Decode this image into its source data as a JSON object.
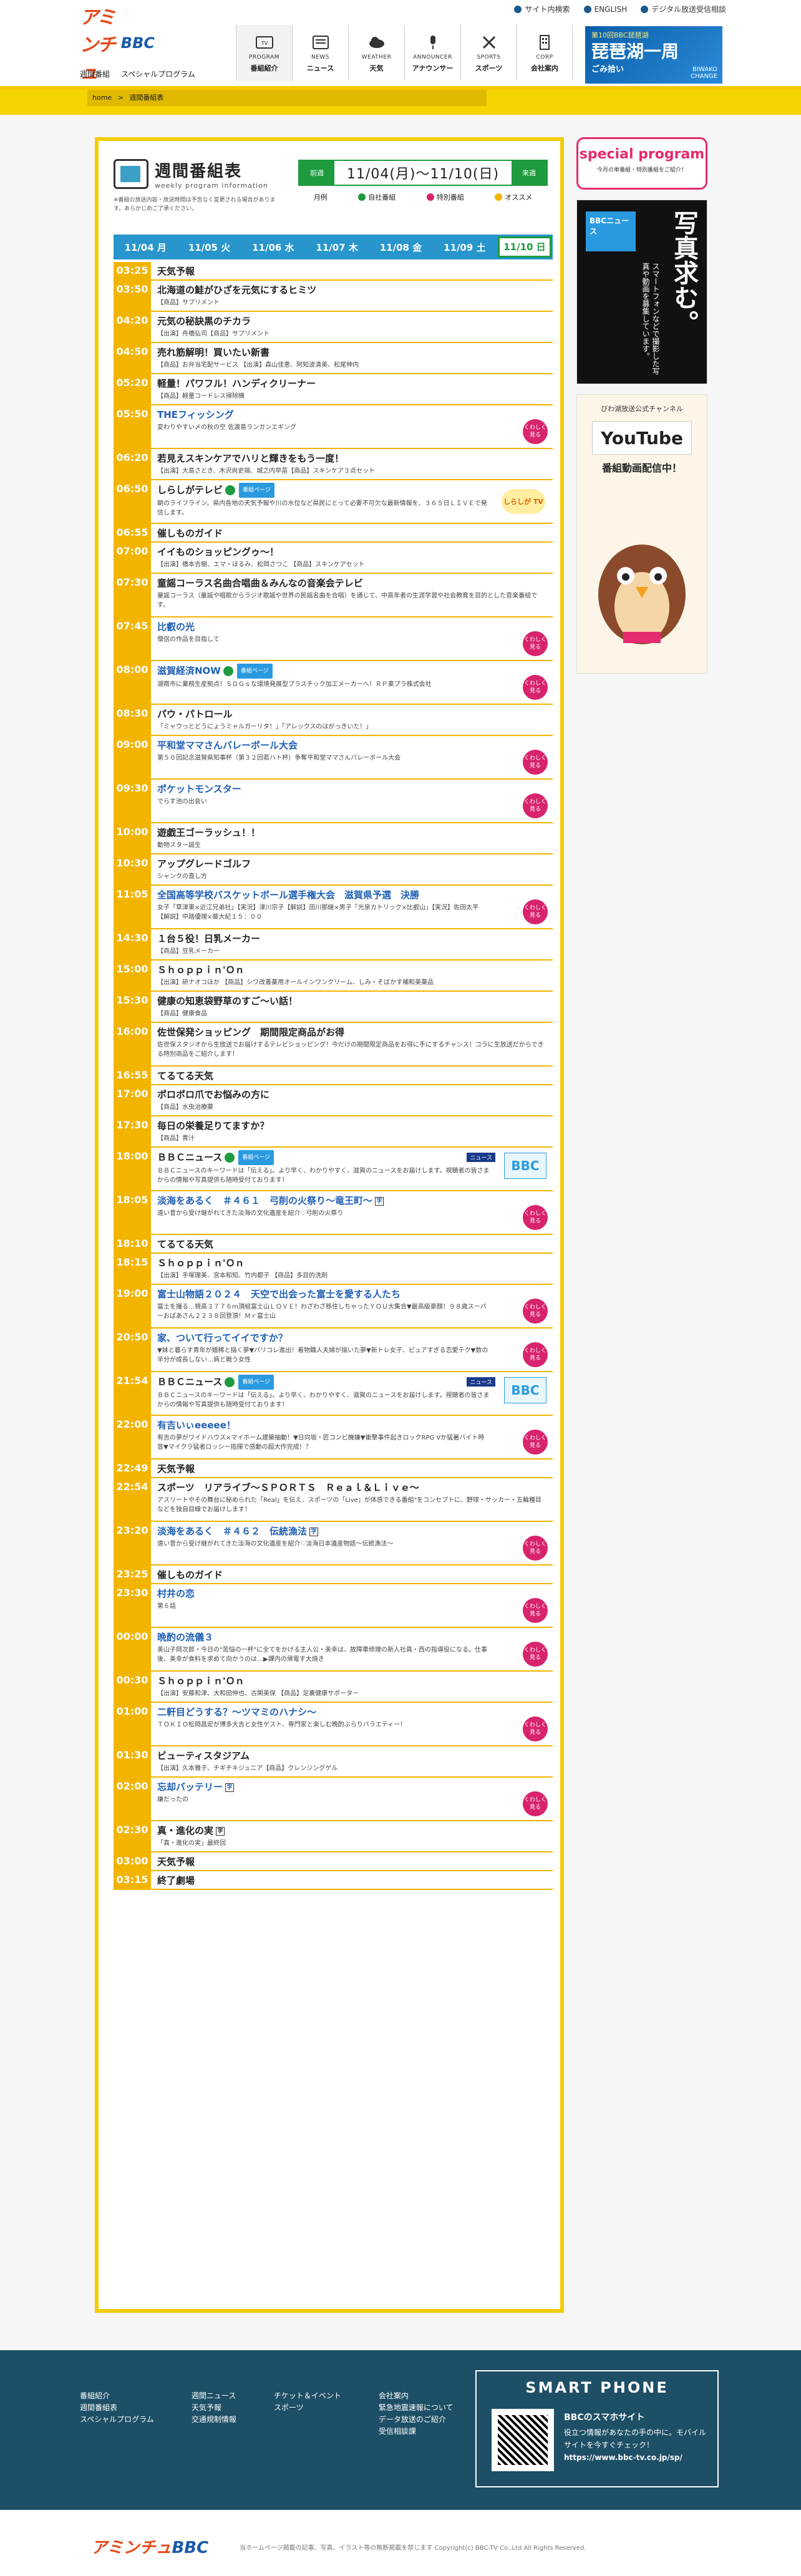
{
  "header": {
    "topbar": [
      "サイト内検索",
      "ENGLISH",
      "デジタル放送受信相談"
    ],
    "logo_a": "アミンチュ",
    "logo_b": "BBC",
    "sublinks": [
      "週間番組",
      "スペシャルプログラム"
    ],
    "nav": [
      {
        "en": "PROGRAM",
        "jp": "番組紹介",
        "icon": "tv-icon"
      },
      {
        "en": "NEWS",
        "jp": "ニュース",
        "icon": "news-icon"
      },
      {
        "en": "WEATHER",
        "jp": "天気",
        "icon": "weather-icon"
      },
      {
        "en": "ANNOUNCER",
        "jp": "アナウンサー",
        "icon": "mic-icon"
      },
      {
        "en": "SPORTS",
        "jp": "スポーツ",
        "icon": "sports-icon"
      },
      {
        "en": "CORP",
        "jp": "会社案内",
        "icon": "building-icon"
      }
    ],
    "banner_top": "第10回BBC琵琶湖",
    "banner_main": "琵琶湖一周",
    "banner_sub": "ごみ拾い",
    "banner_tag": "BIWAKO CHANGE"
  },
  "crumb": {
    "home": "home",
    "sep": ">",
    "current": "週間番組表"
  },
  "schedule": {
    "title": "週間番組表",
    "subtitle": "weekly program information",
    "note": "※番組の放送内容・放送時間は予告なく変更される場合があります。あらかじめご了承ください。",
    "prev": "前週",
    "next": "来週",
    "range": "11/04(月)～11/10(日)",
    "legend": [
      {
        "label": "月例",
        "color": "#ffffff"
      },
      {
        "label": "自社番組",
        "color": "#1d9b3e"
      },
      {
        "label": "特別番組",
        "color": "#d8236d"
      },
      {
        "label": "オススメ",
        "color": "#f3b400"
      }
    ],
    "days": [
      "11/04 月",
      "11/05 火",
      "11/06 水",
      "11/07 木",
      "11/08 金",
      "11/09 土",
      "11/10 日"
    ],
    "selected_day": 6
  },
  "programs": [
    {
      "t": "03:25",
      "title": "天気予報",
      "desc": "",
      "h": 30
    },
    {
      "t": "03:50",
      "title": "北海道の鮭がひざを元気にするヒミツ",
      "desc": "【商品】サプリメント",
      "h": 50
    },
    {
      "t": "04:20",
      "title": "元気の秘訣黒のチカラ",
      "desc": "【出演】舟橋弘司【商品】サプリメント",
      "h": 50
    },
    {
      "t": "04:50",
      "title": "売れ筋解明！買いたい新書",
      "desc": "【商品】お弁当宅配サービス 【出演】森山佳恵、阿知波清美、松尾伸内",
      "h": 50
    },
    {
      "t": "05:20",
      "title": "軽量！パワフル！ハンディクリーナー",
      "desc": "【商品】軽量コードレス掃除機",
      "h": 50
    },
    {
      "t": "05:50",
      "title": "THEフィッシング",
      "desc": "変わりやすい〆の秋の空 佐渡島ランガンエギング",
      "h": 70,
      "blue": true,
      "more": true
    },
    {
      "t": "06:20",
      "title": "若見えスキンケアでハリと輝きをもう一度！",
      "desc": "【出演】大島さとき、木沢尚史瑞、城之内早苗【商品】スキンケア３点セット",
      "h": 50
    },
    {
      "t": "06:50",
      "title": "しらしがテレビ",
      "desc": "朝のライフライン。県内各地の天気予報や川の水位など県民にとって必要不可欠な最新情報を、３６５日ＬＩＶＥで発信します。",
      "h": 70,
      "badge": "番組ページ",
      "ji": true,
      "sghi": "しらしが TV"
    },
    {
      "t": "06:55",
      "title": "催しものガイド",
      "desc": "",
      "h": 30
    },
    {
      "t": "07:00",
      "title": "イイものショッピングゥ～！",
      "desc": "【出演】橋本吉樹、エマ・ほるみ、松岡さつこ 【商品】スキンケアセット",
      "h": 50
    },
    {
      "t": "07:30",
      "title": "童謡コーラス名曲合唱曲＆みんなの音楽会テレビ",
      "desc": "童謡コーラス（童謡や唱歌からラジオ歌謡や世界の民謡名曲を合唱）を通じて、中高年者の生涯学習や社会教育を目的とした音楽番組です。",
      "h": 70
    },
    {
      "t": "07:45",
      "title": "比叡の光",
      "desc": "僧侶の作品を目指して",
      "h": 70,
      "link": true,
      "more": true
    },
    {
      "t": "08:00",
      "title": "滋賀経済NOW",
      "desc": "湖南市に業務生産拠点！ＳＤＧｓな環境発展型プラスチック加工メーカーへ！ＲＰ東プラ株式会社",
      "h": 70,
      "blue": true,
      "badge": "番組ページ",
      "ji": true,
      "more": true
    },
    {
      "t": "08:30",
      "title": "パウ・パトロール",
      "desc": "「ミャウっとどうにょうミャルガーリタ！」「アレックスのはがっきいた！」",
      "h": 50
    },
    {
      "t": "09:00",
      "title": "平和堂ママさんバレーボール大会",
      "desc": "第５０回記念滋賀県知事杯（第３２回若ハト杯）争奪平和堂ママさんバレーボール大会",
      "h": 70,
      "link": true,
      "more": true
    },
    {
      "t": "09:30",
      "title": "ポケットモンスター",
      "desc": "でらす池の出会い",
      "h": 70,
      "link": true,
      "more": true
    },
    {
      "t": "10:00",
      "title": "遊戯王ゴーラッシュ！！",
      "desc": "動物スター誕生",
      "h": 50
    },
    {
      "t": "10:30",
      "title": "アップグレードゴルフ",
      "desc": "シャンクの直し方",
      "h": 50
    },
    {
      "t": "11:05",
      "title": "全国高等学校バスケットボール選手権大会　滋賀県予選　決勝",
      "desc": "女子「草津東×近江兄弟社」【実況】津川宗子【解説】田川那継×男子「光泉カトリック×比叡山」【実況】佐田太平【解説】中路優理×藤大紀１５：００",
      "h": 70,
      "link": true,
      "more": true
    },
    {
      "t": "14:30",
      "title": "１台５役！日乳メーカー",
      "desc": "【商品】豆乳メーカー",
      "h": 50
    },
    {
      "t": "15:00",
      "title": "Ｓｈｏｐｐｉｎ'Ｏｎ",
      "desc": "【出演】研ナオコほか 【商品】シワ改善薬用オールインワンクリーム、しみ・そばかす補和美薬品",
      "h": 50
    },
    {
      "t": "15:30",
      "title": "健康の知恵袋野草のすご〜い話！",
      "desc": "【商品】健康食品",
      "h": 50
    },
    {
      "t": "16:00",
      "title": "佐世保発ショッピング　期間限定商品がお得",
      "desc": "佐世保スタジオから生放送でお届けするテレビショッピング！今だけの期間限定商品をお得に手にするチャンス！コラに生放送だからできる特別商品をご紹介します！",
      "h": 70
    },
    {
      "t": "16:55",
      "title": "てるてる天気",
      "desc": "",
      "h": 30
    },
    {
      "t": "17:00",
      "title": "ポロポロ爪でお悩みの方に",
      "desc": "【商品】水虫治療薬",
      "h": 50
    },
    {
      "t": "17:30",
      "title": "毎日の栄養足りてますか？",
      "desc": "【商品】青汁",
      "h": 50
    },
    {
      "t": "18:00",
      "title": "ＢＢＣニュース",
      "desc": "ＢＢＣニュースのキーワードは「伝える」。より早く、わかりやすく、滋賀のニュースをお届けします。視聴者の皆さまからの情報や写真提供も随時受付ております！",
      "h": 70,
      "badge": "番組ページ",
      "ji": true,
      "news": true
    },
    {
      "t": "18:05",
      "title": "淡海をあるく　＃４６１　弓削の火祭り〜竜王町〜",
      "desc": "遠い昔から受け継がれてきた淡海の文化遺産を紹介♡弓削の火祭り",
      "h": 70,
      "link": true,
      "closebox": true,
      "more": true
    },
    {
      "t": "18:10",
      "title": "てるてる天気",
      "desc": "",
      "h": 30
    },
    {
      "t": "18:15",
      "title": "Ｓｈｏｐｐｉｎ'Ｏｎ",
      "desc": "【出演】手塚理美、宮本和知、竹内都子 【商品】多目的洗剤",
      "h": 50
    },
    {
      "t": "19:00",
      "title": "富士山物語２０２４　天空で出会った富士を愛する人たち",
      "desc": "富士を撮る…視高３７７６ｍ頂組富士山ＬＯＶＥ！わざわざ移住しちゃったＹＯＵ大集合▼最高級豪顔！９８歳スーパーおばあさん２２３８回登頂！Ｍｒ富士山",
      "h": 70,
      "link": true,
      "more": true
    },
    {
      "t": "20:50",
      "title": "家、ついて行ってイイですか？",
      "desc": "▼妹と暮らす青年が婚稀と描く夢▼パリコレ進出！着物職人夫婦が描いた夢▼新トレ女子、ピュアすぎる恋愛テク▼数の半分が成長しない…病と戦う女性",
      "h": 70,
      "link": true,
      "more": true
    },
    {
      "t": "21:54",
      "title": "ＢＢＣニュース",
      "desc": "ＢＢＣニュースのキーワードは「伝える」。より早く、わかりやすく、滋賀のニュースをお届けします。視聴者の皆さまからの情報や写真提供も随時受付ております！",
      "h": 70,
      "badge": "番組ページ",
      "ji": true,
      "news": true
    },
    {
      "t": "22:00",
      "title": "有吉いぃeeeee！",
      "desc": "有吉の夢がワイドハウス×マイホーム建築抽動！▼日向坂・匠コンビ機嫌▼衝撃事件起きロックRPG Vか猛暑バイト時音▼マイクラ猛者ロッシー指揮で感動の超大作完成！？",
      "h": 70,
      "link": true,
      "more": true
    },
    {
      "t": "22:49",
      "title": "天気予報",
      "desc": "",
      "h": 30
    },
    {
      "t": "22:54",
      "title": "スポーツ　リアライブ〜ＳＰＯＲＴＳ　Ｒｅａｌ＆Ｌｉｖｅ〜",
      "desc": "アスリートやその舞台に秘められた「Real」を伝え、スポーツの「Live」が体感できる番組\"をコンセプトに、野球・サッカー・五輪種目などを独自目線でお届けします！",
      "h": 70
    },
    {
      "t": "23:20",
      "title": "淡海をあるく　＃４６２　伝統漁法",
      "desc": "遠い昔から受け継がれてきた淡海の文化遺産を紹介♡淡海日本遺産物語〜伝統漁法〜",
      "h": 70,
      "link": true,
      "closebox": true,
      "more": true
    },
    {
      "t": "23:25",
      "title": "催しものガイド",
      "desc": "",
      "h": 30
    },
    {
      "t": "23:30",
      "title": "村井の恋",
      "desc": "第６話",
      "h": 70,
      "link": true,
      "more": true
    },
    {
      "t": "00:00",
      "title": "晩酌の流儀３",
      "desc": "美山子岡次郎・今日の\"苦悩の一杯\"に全てをかける主人公・美幸は、故障車修理の新人社員・西の指導役になる。仕事後、美幸が食料を求めて向かうのは…▶課内の帰電す大焼き",
      "h": 70,
      "link": true,
      "more": true
    },
    {
      "t": "00:30",
      "title": "Ｓｈｏｐｐｉｎ'Ｏｎ",
      "desc": "【出演】安藤和津、大和田伸也、古閑美保 【商品】足裏健康サポーター",
      "h": 50
    },
    {
      "t": "01:00",
      "title": "二軒目どうする？〜ツマミのハナシ〜",
      "desc": "ＴＯＫＩＯ松岡昌宏が博多大吉と女性ゲスト、専門家と楽しむ晩酌ぶらりバラエティー！",
      "h": 70,
      "link": true,
      "more": true
    },
    {
      "t": "01:30",
      "title": "ビューティスタジアム",
      "desc": "【出演】久本雅子、チギチキジュニア【商品】クレンジングゲル",
      "h": 50
    },
    {
      "t": "02:00",
      "title": "忘却バッテリー",
      "desc": "嫌だったの",
      "h": 70,
      "link": true,
      "closebox": true,
      "more": true
    },
    {
      "t": "02:30",
      "title": "真・進化の実",
      "desc": "「真・進化の実」最終回",
      "h": 50,
      "closebox": true
    },
    {
      "t": "03:00",
      "title": "天気予報",
      "desc": "",
      "h": 30
    },
    {
      "t": "03:15",
      "title": "終了劇場",
      "desc": "",
      "h": 30
    }
  ],
  "more_label": "くわしく見る",
  "news_label": "ニュース",
  "news_logo": "BBC",
  "sidebar": {
    "sp_title": "special program",
    "sp_sub": "今月の単番組・特別番組をご紹介！",
    "photo_logo": "BBCニュース",
    "photo_title": "写真求む。",
    "photo_text": "スマートフォンなどで撮影した写真や動画を募集しています。",
    "yt_top": "びわ湖放送公式チャンネル",
    "yt_logo": "YouTube",
    "yt_sub": "番組動画配信中！"
  },
  "footer": {
    "cols": [
      [
        "番組紹介",
        "週間番組表",
        "スペシャルプログラム"
      ],
      [
        "週間ニュース",
        "天気予報",
        "交通規制情報"
      ],
      [
        "チケット＆イベント",
        "スポーツ"
      ],
      [
        "会社案内",
        "緊急地震速報について",
        "データ放送のご紹介",
        "受信相談課"
      ]
    ],
    "sp_title": "SMART PHONE",
    "sp_head": "BBCのスマホサイト",
    "sp_text": "役立つ情報があなたの手の中に。モバイルサイトを今すぐチェック！",
    "sp_url": "https://www.bbc-tv.co.jp/sp/",
    "copyright": "当ホームページ掲載の記事、写真、イラスト等の無断掲載を禁じます Copyright(c) BBC-TV Co.,Ltd All Rights Reserved."
  }
}
